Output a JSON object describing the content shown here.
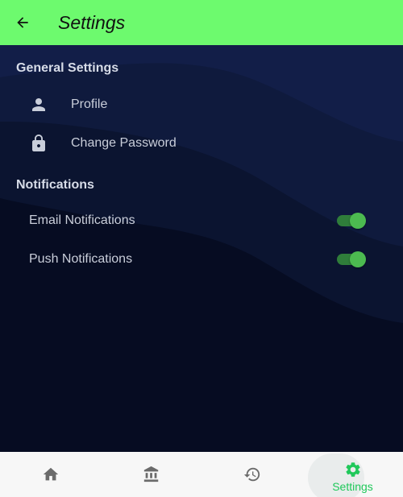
{
  "appbar": {
    "title": "Settings",
    "back_icon": "arrow-back-icon",
    "background": "#6dfa6e"
  },
  "sections": {
    "general": {
      "title": "General Settings",
      "items": [
        {
          "label": "Profile",
          "icon": "person-icon"
        },
        {
          "label": "Change Password",
          "icon": "lock-icon"
        }
      ]
    },
    "notifications": {
      "title": "Notifications",
      "items": [
        {
          "label": "Email Notifications",
          "enabled": true
        },
        {
          "label": "Push Notifications",
          "enabled": true
        }
      ]
    }
  },
  "bottom_nav": {
    "items": [
      {
        "icon": "home-icon",
        "label": ""
      },
      {
        "icon": "bank-icon",
        "label": ""
      },
      {
        "icon": "history-icon",
        "label": ""
      },
      {
        "icon": "settings-gear-icon",
        "label": "Settings",
        "active": true
      }
    ],
    "active_color": "#1fc85a"
  },
  "colors": {
    "background": "#070d22",
    "switch_on": "#4cba50"
  }
}
